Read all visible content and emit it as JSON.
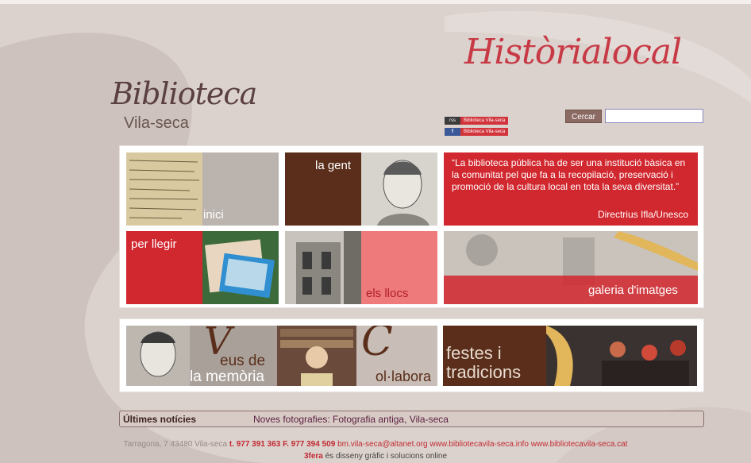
{
  "header": {
    "logo_script": "Biblioteca",
    "logo_sub": "Vila-seca",
    "section_title": "Històrialocal"
  },
  "social": [
    {
      "icon": "rss",
      "label": "Biblioteca Vila-seca"
    },
    {
      "icon": "f",
      "label": "Biblioteca Vila-seca"
    }
  ],
  "search": {
    "button": "Cercar",
    "value": ""
  },
  "tiles": {
    "inici": "inici",
    "la_gent": "la gent",
    "per_llegir": "per llegir",
    "els_llocs": "els llocs",
    "galeria": "galeria d'imatges",
    "veus_big": "V",
    "veus_rest1": "eus de",
    "veus_rest2": "la memòria",
    "col_big": "C",
    "col_rest": "ol·labora",
    "festes1": "festes i",
    "festes2": "tradicions"
  },
  "quote": {
    "text": "“La biblioteca pública ha de ser una institució bàsica en la comunitat pel que fa a la recopilació, preservació i promoció de la cultura local en tota la seva diversitat.”",
    "author": "Directrius Ifla/Unesco"
  },
  "news": {
    "heading": "Últimes notícies",
    "item": "Noves fotografies: Fotografia antiga, Vila-seca"
  },
  "footer": {
    "address": "Tarragona, 7 43480 Vila-seca",
    "phones": "t. 977 391 363 F. 977 394 509",
    "email": "bm.vila-seca@altanet.org",
    "web1": "www.bibliotecavila-seca.info",
    "web2": "www.bibliotecavila-seca.cat",
    "credit_brand": "3fera",
    "credit_text": "és disseny gràfic i solucions online"
  }
}
